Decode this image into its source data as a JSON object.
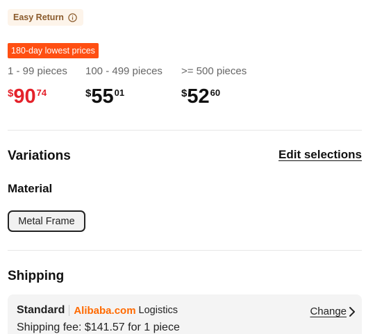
{
  "easy_return": {
    "label": "Easy Return",
    "icon": "info-icon"
  },
  "badge": {
    "label": "180-day lowest prices"
  },
  "tiers": [
    {
      "range": "1 - 99 pieces",
      "currency": "$",
      "int": "90",
      "dec": "74"
    },
    {
      "range": "100 - 499 pieces",
      "currency": "$",
      "int": "55",
      "dec": "01"
    },
    {
      "range": ">= 500 pieces",
      "currency": "$",
      "int": "52",
      "dec": "60"
    }
  ],
  "variations": {
    "title": "Variations",
    "edit_label": "Edit selections"
  },
  "material": {
    "label": "Material",
    "options": [
      "Metal Frame"
    ]
  },
  "shipping": {
    "title": "Shipping",
    "method": "Standard",
    "brand": "Alibaba.com",
    "logistics": "Logistics",
    "change_label": "Change",
    "fee": "Shipping fee: $141.57 for 1 piece"
  },
  "colors": {
    "accent_red": "#e4222b",
    "badge_orange": "#ff4f12",
    "brand_orange": "#ff6a00"
  }
}
